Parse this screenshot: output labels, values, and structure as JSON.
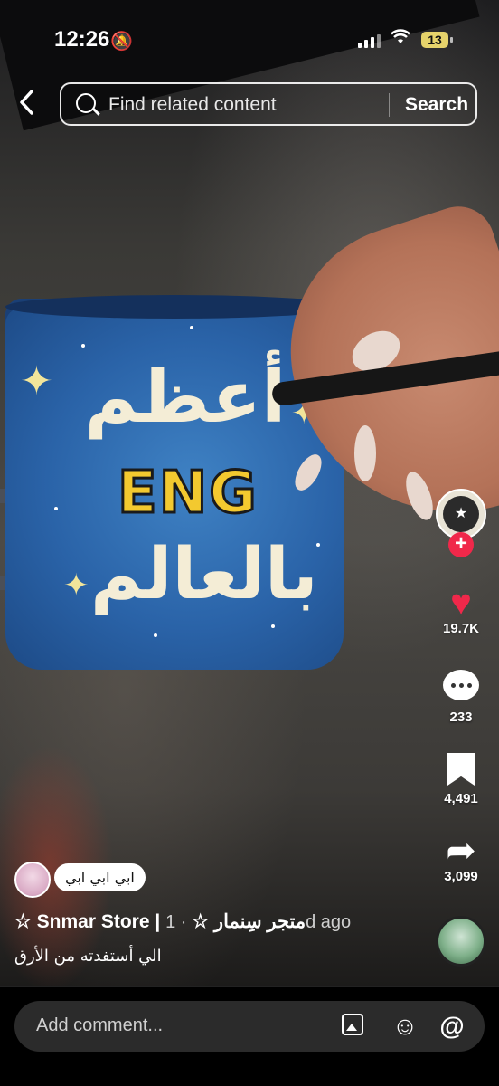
{
  "status_bar": {
    "time": "12:26",
    "battery": "13"
  },
  "search": {
    "placeholder": "Find related content",
    "button": "Search"
  },
  "mug": {
    "line1": "أعظم",
    "line2": "ENG",
    "line3": "بالعالم"
  },
  "rail": {
    "likes": "19.7K",
    "comments": "233",
    "saves": "4,491",
    "shares": "3,099"
  },
  "caption": {
    "sticker": "ابي ابي ابي",
    "author": "☆ Snmar Store | متجر سِنمار ☆",
    "ago": "· 1d ago",
    "description": "الي أستفدته من الأرق"
  },
  "comment": {
    "placeholder": "Add comment..."
  },
  "colors": {
    "like": "#f0284a",
    "mug_blue": "#2a63a8",
    "eng_yellow": "#f3c92f"
  },
  "icons": [
    "chevron-left-icon",
    "search-icon",
    "heart-icon",
    "comment-icon",
    "bookmark-icon",
    "share-icon",
    "image-icon",
    "emoji-icon",
    "at-icon",
    "bell-slash-icon",
    "wifi-icon",
    "signal-icon"
  ]
}
